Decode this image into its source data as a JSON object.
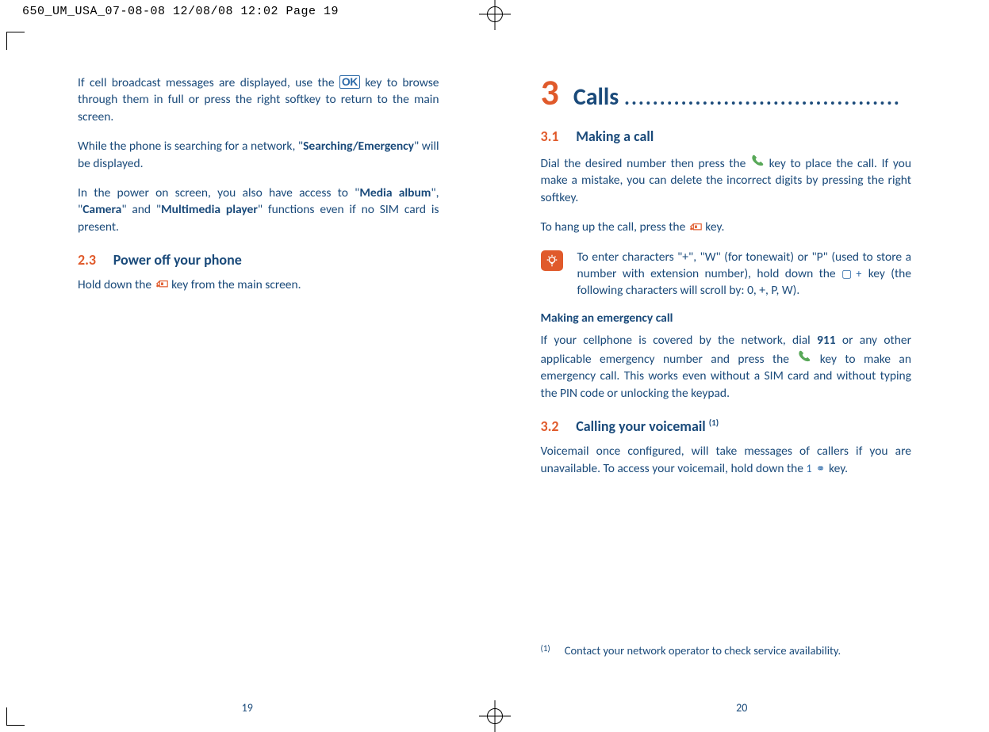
{
  "header": "650_UM_USA_07-08-08  12/08/08  12:02  Page 19",
  "left": {
    "p1a": "If cell broadcast messages are displayed, use the ",
    "p1b": " key to browse through them in full or press the right softkey to return to the main screen.",
    "p2a": "While the phone is searching for a network, \"",
    "p2b": "Searching/Emergency",
    "p2c": "\" will be displayed.",
    "p3a": "In the power on screen, you also have access to \"",
    "p3b": "Media album",
    "p3c": "\", \"",
    "p3d": "Camera",
    "p3e": "\" and \"",
    "p3f": "Multimedia player",
    "p3g": "\" functions even if no SIM card is present.",
    "sec23_num": "2.3",
    "sec23_title": "Power off your phone",
    "p4a": "Hold down the ",
    "p4b": " key from the main screen.",
    "pagenum": "19"
  },
  "right": {
    "chap_num": "3",
    "chap_title": "Calls",
    "dots": ".......................................",
    "sec31_num": "3.1",
    "sec31_title": "Making a call",
    "p1a": "Dial the desired number then press the ",
    "p1b": " key to place the call. If you make a mistake, you can delete the incorrect digits by pressing the right softkey.",
    "p2a": "To hang up the call, press the ",
    "p2b": " key.",
    "tip_a": "To enter characters \"+\", \"W\" (for tonewait) or \"P\" (used to store a number with extension number), hold down the ",
    "tip_b": " key (the following characters will scroll by: 0, +, P, W).",
    "subhead": "Making an emergency call",
    "p3a": "If your cellphone is covered by the network, dial ",
    "p3b": "911",
    "p3c": " or any other applicable emergency number and press the ",
    "p3d": " key to make an emergency call.  This works even without a SIM card and without typing the PIN code or unlocking the keypad.",
    "sec32_num": "3.2",
    "sec32_title": "Calling your voicemail ",
    "sec32_sup": "(1)",
    "p4a": "Voicemail once configured, will take messages of callers if you are unavailable.  To access your voicemail, hold down the ",
    "p4b": " key.",
    "fn_mark": "(1)",
    "fn_text": "Contact your network operator to check service availability.",
    "pagenum": "20"
  }
}
